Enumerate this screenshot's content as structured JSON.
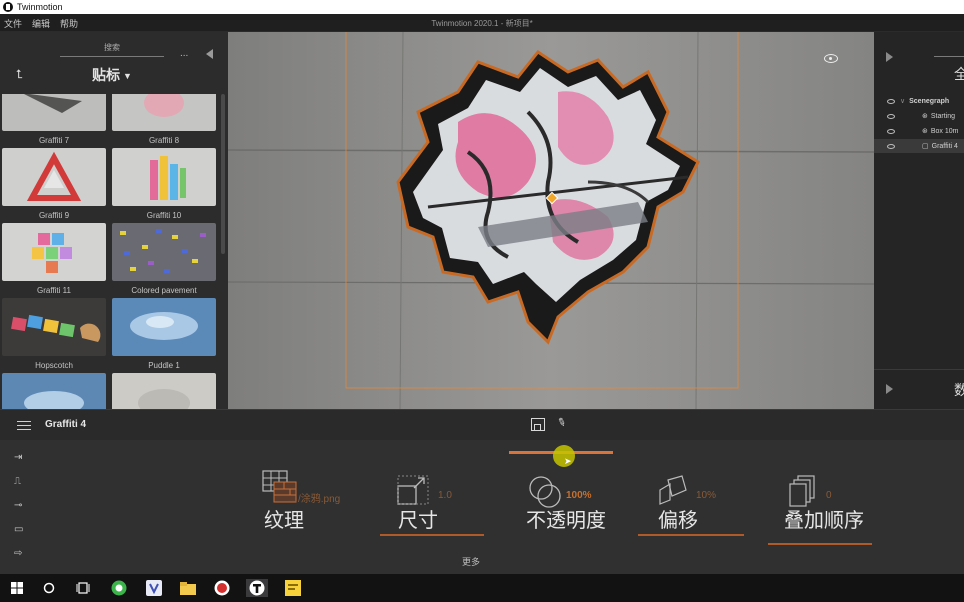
{
  "os_title": "Twinmotion",
  "menubar": {
    "menus": [
      "文件",
      "编辑",
      "帮助"
    ],
    "doc_title": "Twinmotion 2020.1 - 新项目*"
  },
  "library": {
    "search_label": "搜索",
    "more": "...",
    "category": "贴标",
    "tiles": [
      {
        "label": "Graffiti 7",
        "thumb": "graffiti-7"
      },
      {
        "label": "Graffiti 8",
        "thumb": "graffiti-8"
      },
      {
        "label": "Graffiti 9",
        "thumb": "graffiti-9"
      },
      {
        "label": "Graffiti 10",
        "thumb": "graffiti-10"
      },
      {
        "label": "Graffiti 11",
        "thumb": "graffiti-11"
      },
      {
        "label": "Colored pavement",
        "thumb": "colored-pavement"
      },
      {
        "label": "Hopscotch",
        "thumb": "hopscotch"
      },
      {
        "label": "Puddle 1",
        "thumb": "puddle-1"
      },
      {
        "label": "",
        "thumb": "puddle-2"
      },
      {
        "label": "",
        "thumb": "stain"
      }
    ]
  },
  "scene": {
    "right_top_char": "全",
    "right_bottom_char": "数",
    "items": [
      {
        "label": "Scenegraph",
        "indent": 0
      },
      {
        "label": "Starting",
        "indent": 1
      },
      {
        "label": "Box 10m",
        "indent": 1
      },
      {
        "label": "Graffiti 4",
        "indent": 1
      }
    ]
  },
  "bottom": {
    "object_name": "Graffiti 4",
    "more_label": "更多"
  },
  "properties": [
    {
      "label": "纹理",
      "value": "…/涂鸦.png",
      "icon": "texture-icon"
    },
    {
      "label": "尺寸",
      "value": "1.0",
      "icon": "size-icon"
    },
    {
      "label": "不透明度",
      "value": "100%",
      "icon": "opacity-icon"
    },
    {
      "label": "偏移",
      "value": "10%",
      "icon": "offset-icon"
    },
    {
      "label": "叠加顺序",
      "value": "0",
      "icon": "stack-order-icon"
    }
  ],
  "colors": {
    "accent": "#d9743a",
    "panel": "#2c2c2d",
    "viewport_wall": "#8e8e8c",
    "selection_orange": "#e58a3a"
  },
  "taskbar": [
    "windows-icon",
    "search-circle-icon",
    "task-view-icon",
    "browser-icon",
    "shield-app-icon",
    "folder-icon",
    "record-icon",
    "twinmotion-icon",
    "notes-icon"
  ]
}
